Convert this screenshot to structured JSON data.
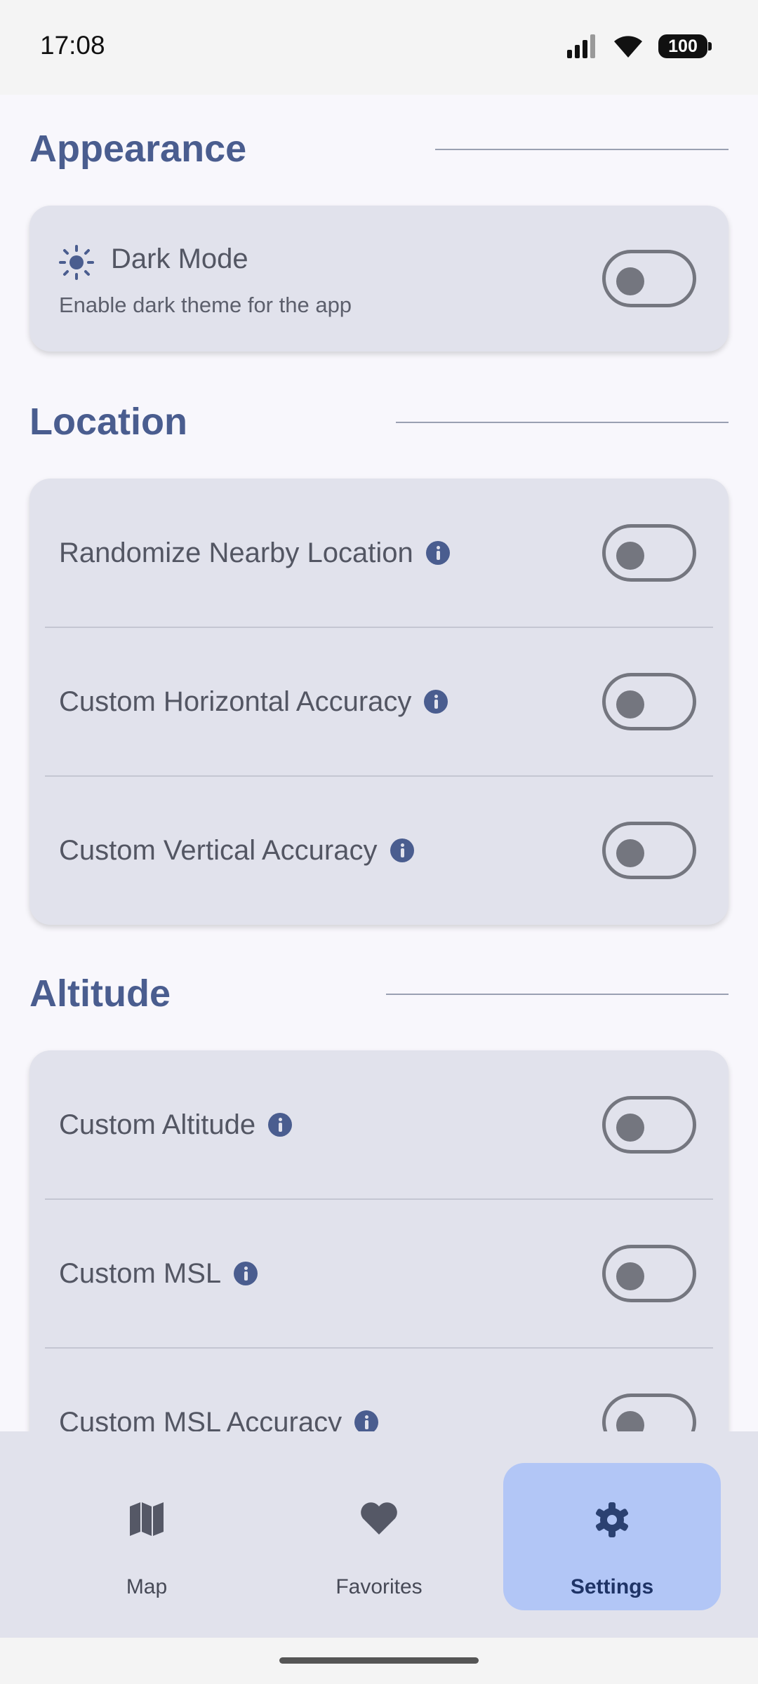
{
  "status_bar": {
    "time": "17:08",
    "battery": "100"
  },
  "sections": {
    "appearance": {
      "title": "Appearance",
      "dark_mode": {
        "label": "Dark Mode",
        "description": "Enable dark theme for the app",
        "enabled": false
      }
    },
    "location": {
      "title": "Location",
      "items": [
        {
          "label": "Randomize Nearby Location",
          "enabled": false
        },
        {
          "label": "Custom Horizontal Accuracy",
          "enabled": false
        },
        {
          "label": "Custom Vertical Accuracy",
          "enabled": false
        }
      ]
    },
    "altitude": {
      "title": "Altitude",
      "items": [
        {
          "label": "Custom Altitude",
          "enabled": false
        },
        {
          "label": "Custom MSL",
          "enabled": false
        },
        {
          "label": "Custom MSL Accuracy",
          "enabled": false
        }
      ]
    }
  },
  "nav": {
    "items": [
      {
        "label": "Map",
        "icon": "map-icon",
        "active": false
      },
      {
        "label": "Favorites",
        "icon": "heart-icon",
        "active": false
      },
      {
        "label": "Settings",
        "icon": "gear-icon",
        "active": true
      }
    ]
  },
  "colors": {
    "accent": "#4a5d8f",
    "card": "#e1e2ec",
    "nav_active": "#b2c6f6"
  }
}
